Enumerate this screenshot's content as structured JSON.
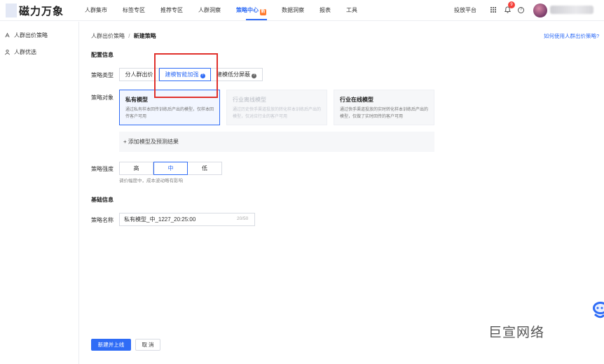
{
  "app": {
    "logo_text": "磁力万象"
  },
  "topnav": {
    "items": [
      "人群集市",
      "标签专区",
      "推荐专区",
      "人群洞察",
      "策略中心",
      "数据洞察",
      "报表",
      "工具"
    ],
    "active_index": 4,
    "active_badge": "新",
    "ad_platform": "投放平台",
    "notification_count": "9",
    "help_symbol": "?"
  },
  "sidebar": {
    "items": [
      {
        "label": "人群出价策略",
        "icon": "bid-strategy-icon"
      },
      {
        "label": "人群优选",
        "icon": "audience-icon"
      }
    ]
  },
  "breadcrumb": {
    "parent": "人群出价策略",
    "separator": "/",
    "current": "新建策略"
  },
  "help_link": "如何使用人群出价策略?",
  "config": {
    "section_title": "配置信息",
    "strategy_type": {
      "label": "策略类型",
      "options": [
        "分人群出价",
        "建模智能加强",
        "建模低分屏蔽"
      ],
      "selected_index": 1,
      "info_symbol": "?"
    },
    "strategy_target": {
      "label": "策略对象",
      "cards": [
        {
          "title": "私有模型",
          "desc": "通过私有样本回传训练后产出的模型，仅样本回传客户可用",
          "state": "selected"
        },
        {
          "title": "行业离线模型",
          "desc": "通过历史快手渠道投放的转化样本训练后产出的模型，仅对应行业的客户可用",
          "state": "disabled"
        },
        {
          "title": "行业在线模型",
          "desc": "通过快手渠道投放的实时转化样本训练后产出的模型，仅做了实时回传的客户可用",
          "state": "normal"
        }
      ],
      "add_model_label": "+ 添加模型及预测结果"
    },
    "strategy_strength": {
      "label": "策略强度",
      "options": [
        "高",
        "中",
        "低"
      ],
      "selected_index": 1,
      "hint": "调价幅度中，成本波动略有影响"
    }
  },
  "basic": {
    "section_title": "基础信息",
    "name_label": "策略名称",
    "name_value": "私有模型_中_1227_20:25:00",
    "name_count": "20/50"
  },
  "footer": {
    "submit_label": "新建并上线",
    "cancel_label": "取 消"
  },
  "watermark": "巨宣网络",
  "colors": {
    "accent": "#2f6cf6",
    "annotation_red": "#e0302b",
    "badge_orange": "#ff7a2e"
  }
}
